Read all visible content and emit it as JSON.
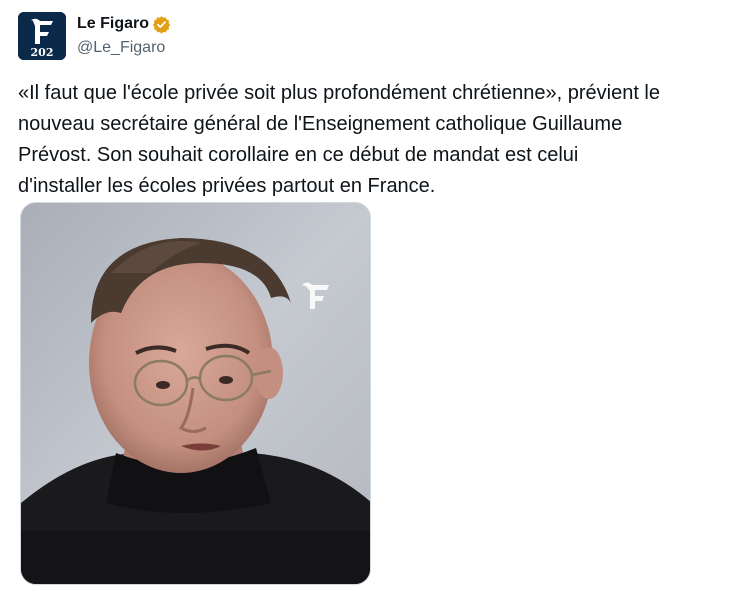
{
  "account": {
    "display_name": "Le Figaro",
    "handle": "@Le_Figaro",
    "verified": true,
    "verified_badge_color": "#e2a114",
    "avatar_text": "202"
  },
  "tweet": {
    "text_lines": [
      "«Il faut que l'école privée soit plus profondément chrétienne», prévient le",
      "nouveau secrétaire général de l'Enseignement catholique Guillaume",
      "Prévost. Son souhait corollaire en ce début de mandat est celui",
      "d'installer les écoles privées partout en France."
    ]
  },
  "media": {
    "type": "video-thumbnail",
    "watermark_icon": "figaro-logo-icon"
  },
  "colors": {
    "text": "#0f1419",
    "secondary_text": "#536471",
    "avatar_bg": "#0b2a4a"
  }
}
